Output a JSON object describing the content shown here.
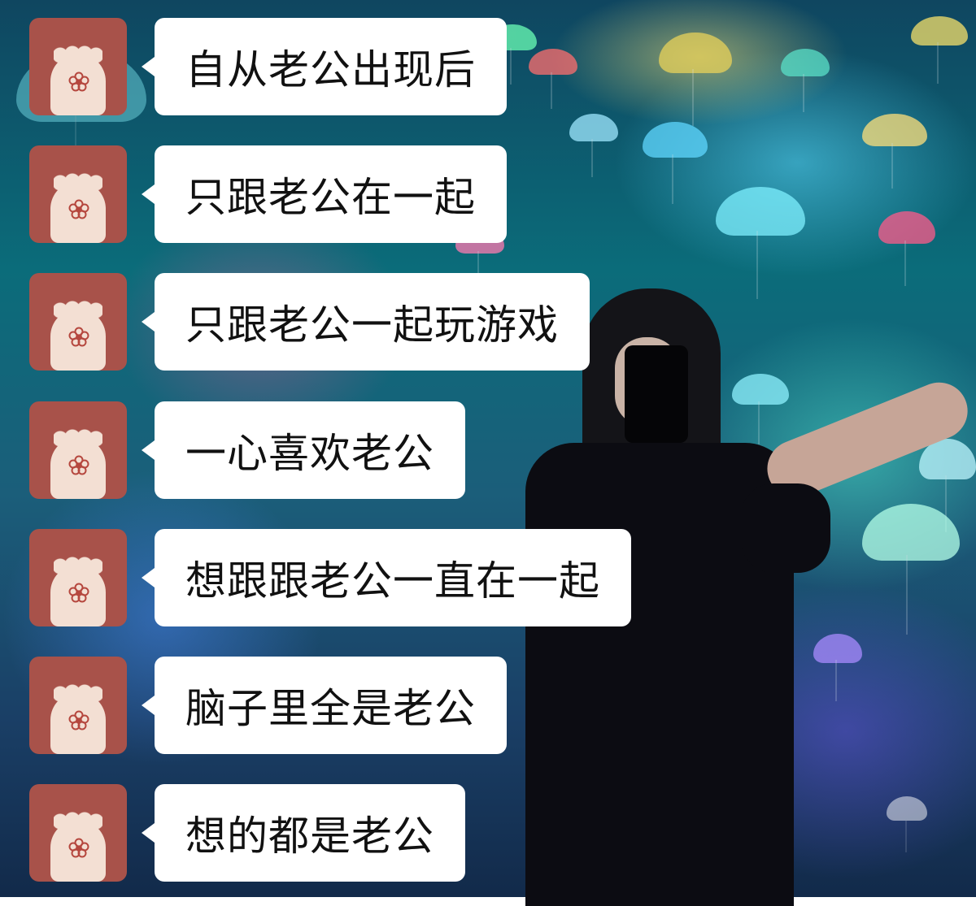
{
  "theme": {
    "bubble_bg": "#ffffff",
    "text_color": "#111111",
    "avatar_bg": "#a8524a",
    "avatar_paw": "#f3dfd3",
    "flower_color": "#b5473e"
  },
  "background": {
    "description_icon": "jellyfish-light-installation-photo"
  },
  "messages": [
    {
      "text": "自从老公出现后",
      "avatar_icon": "cat-paw-flower-icon"
    },
    {
      "text": "只跟老公在一起",
      "avatar_icon": "cat-paw-flower-icon"
    },
    {
      "text": "只跟老公一起玩游戏",
      "avatar_icon": "cat-paw-flower-icon"
    },
    {
      "text": "一心喜欢老公",
      "avatar_icon": "cat-paw-flower-icon"
    },
    {
      "text": "想跟跟老公一直在一起",
      "avatar_icon": "cat-paw-flower-icon"
    },
    {
      "text": "脑子里全是老公",
      "avatar_icon": "cat-paw-flower-icon"
    },
    {
      "text": "想的都是老公",
      "avatar_icon": "cat-paw-flower-icon"
    }
  ]
}
